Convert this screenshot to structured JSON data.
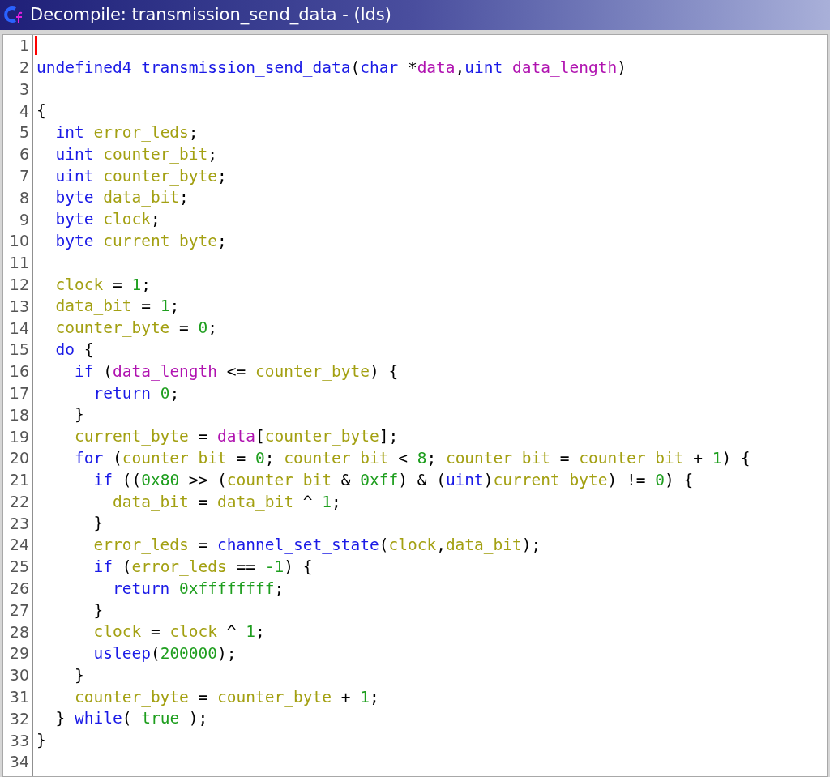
{
  "window": {
    "title": "Decompile: transmission_send_data -  (lds)"
  },
  "lines": [
    {
      "number": "1",
      "cursor": true
    },
    {
      "number": "2",
      "cursor": false,
      "tokens": [
        {
          "kind": "type",
          "text": "undefined4 "
        },
        {
          "kind": "func",
          "text": "transmission_send_data"
        },
        {
          "kind": "plain",
          "text": "("
        },
        {
          "kind": "type",
          "text": "char"
        },
        {
          "kind": "plain",
          "text": " *"
        },
        {
          "kind": "param",
          "text": "data"
        },
        {
          "kind": "plain",
          "text": ","
        },
        {
          "kind": "type",
          "text": "uint "
        },
        {
          "kind": "param",
          "text": "data_length"
        },
        {
          "kind": "plain",
          "text": ")"
        }
      ]
    },
    {
      "number": "3",
      "cursor": false
    },
    {
      "number": "4",
      "cursor": false,
      "tokens": [
        {
          "kind": "plain",
          "text": "{"
        }
      ]
    },
    {
      "number": "5",
      "cursor": false,
      "tokens": [
        {
          "kind": "type",
          "text": "  int "
        },
        {
          "kind": "var",
          "text": "error_leds"
        },
        {
          "kind": "plain",
          "text": ";"
        }
      ]
    },
    {
      "number": "6",
      "cursor": false,
      "tokens": [
        {
          "kind": "type",
          "text": "  uint "
        },
        {
          "kind": "var",
          "text": "counter_bit"
        },
        {
          "kind": "plain",
          "text": ";"
        }
      ]
    },
    {
      "number": "7",
      "cursor": false,
      "tokens": [
        {
          "kind": "type",
          "text": "  uint "
        },
        {
          "kind": "var",
          "text": "counter_byte"
        },
        {
          "kind": "plain",
          "text": ";"
        }
      ]
    },
    {
      "number": "8",
      "cursor": false,
      "tokens": [
        {
          "kind": "type",
          "text": "  byte "
        },
        {
          "kind": "var",
          "text": "data_bit"
        },
        {
          "kind": "plain",
          "text": ";"
        }
      ]
    },
    {
      "number": "9",
      "cursor": false,
      "tokens": [
        {
          "kind": "type",
          "text": "  byte "
        },
        {
          "kind": "var",
          "text": "clock"
        },
        {
          "kind": "plain",
          "text": ";"
        }
      ]
    },
    {
      "number": "10",
      "cursor": false,
      "tokens": [
        {
          "kind": "type",
          "text": "  byte "
        },
        {
          "kind": "var",
          "text": "current_byte"
        },
        {
          "kind": "plain",
          "text": ";"
        }
      ]
    },
    {
      "number": "11",
      "cursor": false
    },
    {
      "number": "12",
      "cursor": false,
      "tokens": [
        {
          "kind": "var",
          "text": "  clock"
        },
        {
          "kind": "plain",
          "text": " = "
        },
        {
          "kind": "const",
          "text": "1"
        },
        {
          "kind": "plain",
          "text": ";"
        }
      ]
    },
    {
      "number": "13",
      "cursor": false,
      "tokens": [
        {
          "kind": "var",
          "text": "  data_bit"
        },
        {
          "kind": "plain",
          "text": " = "
        },
        {
          "kind": "const",
          "text": "1"
        },
        {
          "kind": "plain",
          "text": ";"
        }
      ]
    },
    {
      "number": "14",
      "cursor": false,
      "tokens": [
        {
          "kind": "var",
          "text": "  counter_byte"
        },
        {
          "kind": "plain",
          "text": " = "
        },
        {
          "kind": "const",
          "text": "0"
        },
        {
          "kind": "plain",
          "text": ";"
        }
      ]
    },
    {
      "number": "15",
      "cursor": false,
      "tokens": [
        {
          "kind": "keyword",
          "text": "  do"
        },
        {
          "kind": "plain",
          "text": " {"
        }
      ]
    },
    {
      "number": "16",
      "cursor": false,
      "tokens": [
        {
          "kind": "keyword",
          "text": "    if"
        },
        {
          "kind": "plain",
          "text": " ("
        },
        {
          "kind": "param",
          "text": "data_length"
        },
        {
          "kind": "plain",
          "text": " <= "
        },
        {
          "kind": "var",
          "text": "counter_byte"
        },
        {
          "kind": "plain",
          "text": ") {"
        }
      ]
    },
    {
      "number": "17",
      "cursor": false,
      "tokens": [
        {
          "kind": "keyword",
          "text": "      return "
        },
        {
          "kind": "const",
          "text": "0"
        },
        {
          "kind": "plain",
          "text": ";"
        }
      ]
    },
    {
      "number": "18",
      "cursor": false,
      "tokens": [
        {
          "kind": "plain",
          "text": "    }"
        }
      ]
    },
    {
      "number": "19",
      "cursor": false,
      "tokens": [
        {
          "kind": "var",
          "text": "    current_byte"
        },
        {
          "kind": "plain",
          "text": " = "
        },
        {
          "kind": "param",
          "text": "data"
        },
        {
          "kind": "plain",
          "text": "["
        },
        {
          "kind": "var",
          "text": "counter_byte"
        },
        {
          "kind": "plain",
          "text": "];"
        }
      ]
    },
    {
      "number": "20",
      "cursor": false,
      "tokens": [
        {
          "kind": "keyword",
          "text": "    for"
        },
        {
          "kind": "plain",
          "text": " ("
        },
        {
          "kind": "var",
          "text": "counter_bit"
        },
        {
          "kind": "plain",
          "text": " = "
        },
        {
          "kind": "const",
          "text": "0"
        },
        {
          "kind": "plain",
          "text": "; "
        },
        {
          "kind": "var",
          "text": "counter_bit"
        },
        {
          "kind": "plain",
          "text": " < "
        },
        {
          "kind": "const",
          "text": "8"
        },
        {
          "kind": "plain",
          "text": "; "
        },
        {
          "kind": "var",
          "text": "counter_bit"
        },
        {
          "kind": "plain",
          "text": " = "
        },
        {
          "kind": "var",
          "text": "counter_bit"
        },
        {
          "kind": "plain",
          "text": " + "
        },
        {
          "kind": "const",
          "text": "1"
        },
        {
          "kind": "plain",
          "text": ") {"
        }
      ]
    },
    {
      "number": "21",
      "cursor": false,
      "tokens": [
        {
          "kind": "keyword",
          "text": "      if"
        },
        {
          "kind": "plain",
          "text": " (("
        },
        {
          "kind": "const",
          "text": "0x80"
        },
        {
          "kind": "plain",
          "text": " >> ("
        },
        {
          "kind": "var",
          "text": "counter_bit"
        },
        {
          "kind": "plain",
          "text": " & "
        },
        {
          "kind": "const",
          "text": "0xff"
        },
        {
          "kind": "plain",
          "text": ") & ("
        },
        {
          "kind": "type",
          "text": "uint"
        },
        {
          "kind": "plain",
          "text": ")"
        },
        {
          "kind": "var",
          "text": "current_byte"
        },
        {
          "kind": "plain",
          "text": ") != "
        },
        {
          "kind": "const",
          "text": "0"
        },
        {
          "kind": "plain",
          "text": ") {"
        }
      ]
    },
    {
      "number": "22",
      "cursor": false,
      "tokens": [
        {
          "kind": "var",
          "text": "        data_bit"
        },
        {
          "kind": "plain",
          "text": " = "
        },
        {
          "kind": "var",
          "text": "data_bit"
        },
        {
          "kind": "plain",
          "text": " ^ "
        },
        {
          "kind": "const",
          "text": "1"
        },
        {
          "kind": "plain",
          "text": ";"
        }
      ]
    },
    {
      "number": "23",
      "cursor": false,
      "tokens": [
        {
          "kind": "plain",
          "text": "      }"
        }
      ]
    },
    {
      "number": "24",
      "cursor": false,
      "tokens": [
        {
          "kind": "var",
          "text": "      error_leds"
        },
        {
          "kind": "plain",
          "text": " = "
        },
        {
          "kind": "func",
          "text": "channel_set_state"
        },
        {
          "kind": "plain",
          "text": "("
        },
        {
          "kind": "var",
          "text": "clock"
        },
        {
          "kind": "plain",
          "text": ","
        },
        {
          "kind": "var",
          "text": "data_bit"
        },
        {
          "kind": "plain",
          "text": ");"
        }
      ]
    },
    {
      "number": "25",
      "cursor": false,
      "tokens": [
        {
          "kind": "keyword",
          "text": "      if"
        },
        {
          "kind": "plain",
          "text": " ("
        },
        {
          "kind": "var",
          "text": "error_leds"
        },
        {
          "kind": "plain",
          "text": " == "
        },
        {
          "kind": "const",
          "text": "-1"
        },
        {
          "kind": "plain",
          "text": ") {"
        }
      ]
    },
    {
      "number": "26",
      "cursor": false,
      "tokens": [
        {
          "kind": "keyword",
          "text": "        return "
        },
        {
          "kind": "const",
          "text": "0xffffffff"
        },
        {
          "kind": "plain",
          "text": ";"
        }
      ]
    },
    {
      "number": "27",
      "cursor": false,
      "tokens": [
        {
          "kind": "plain",
          "text": "      }"
        }
      ]
    },
    {
      "number": "28",
      "cursor": false,
      "tokens": [
        {
          "kind": "var",
          "text": "      clock"
        },
        {
          "kind": "plain",
          "text": " = "
        },
        {
          "kind": "var",
          "text": "clock"
        },
        {
          "kind": "plain",
          "text": " ^ "
        },
        {
          "kind": "const",
          "text": "1"
        },
        {
          "kind": "plain",
          "text": ";"
        }
      ]
    },
    {
      "number": "29",
      "cursor": false,
      "tokens": [
        {
          "kind": "func",
          "text": "      usleep"
        },
        {
          "kind": "plain",
          "text": "("
        },
        {
          "kind": "const",
          "text": "200000"
        },
        {
          "kind": "plain",
          "text": ");"
        }
      ]
    },
    {
      "number": "30",
      "cursor": false,
      "tokens": [
        {
          "kind": "plain",
          "text": "    }"
        }
      ]
    },
    {
      "number": "31",
      "cursor": false,
      "tokens": [
        {
          "kind": "var",
          "text": "    counter_byte"
        },
        {
          "kind": "plain",
          "text": " = "
        },
        {
          "kind": "var",
          "text": "counter_byte"
        },
        {
          "kind": "plain",
          "text": " + "
        },
        {
          "kind": "const",
          "text": "1"
        },
        {
          "kind": "plain",
          "text": ";"
        }
      ]
    },
    {
      "number": "32",
      "cursor": false,
      "tokens": [
        {
          "kind": "plain",
          "text": "  } "
        },
        {
          "kind": "keyword",
          "text": "while"
        },
        {
          "kind": "plain",
          "text": "( "
        },
        {
          "kind": "const",
          "text": "true"
        },
        {
          "kind": "plain",
          "text": " );"
        }
      ]
    },
    {
      "number": "33",
      "cursor": false,
      "tokens": [
        {
          "kind": "plain",
          "text": "}"
        }
      ]
    },
    {
      "number": "34",
      "cursor": false
    }
  ]
}
